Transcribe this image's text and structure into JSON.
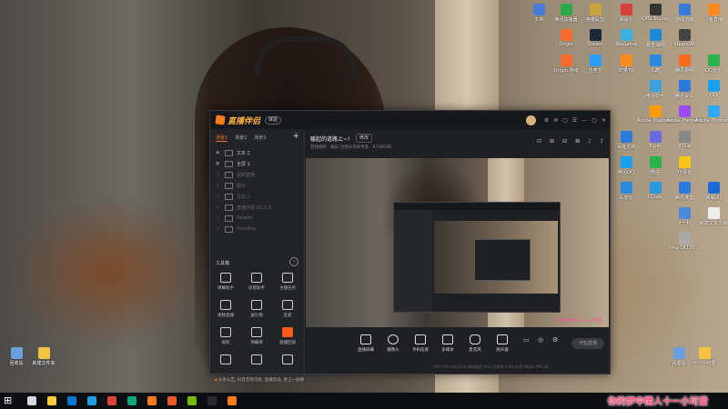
{
  "app": {
    "name": "直播伴侣",
    "badge": "体验",
    "window_controls": [
      "⚙",
      "✉",
      "▢",
      "☰",
      "—",
      "▢",
      "✕"
    ]
  },
  "left_panel": {
    "tabs": [
      "场景1",
      "场景2",
      "场景3"
    ],
    "add": "+",
    "sources": [
      {
        "label": "文本 2",
        "active": true
      },
      {
        "label": "全屏 1",
        "active": true
      },
      {
        "label": "视频直播",
        "active": false
      },
      {
        "label": "图片",
        "active": false
      },
      {
        "label": "文本 1",
        "active": false
      },
      {
        "label": "直播伴侣 V1.2.0",
        "active": false
      },
      {
        "label": "Paladin",
        "active": false
      },
      {
        "label": "Paradise",
        "active": false
      }
    ],
    "tools_title": "工具箱",
    "tools": [
      {
        "label": "弹幕助手",
        "hot": false
      },
      {
        "label": "房管助手",
        "hot": false
      },
      {
        "label": "主播任务",
        "hot": false
      },
      {
        "label": "视频直播",
        "hot": false
      },
      {
        "label": "送礼物",
        "hot": false
      },
      {
        "label": "连麦",
        "hot": false
      },
      {
        "label": "福利",
        "hot": false
      },
      {
        "label": "弹幕库",
        "hot": false
      },
      {
        "label": "直播回放",
        "hot": true
      },
      {
        "label": "",
        "hot": false
      },
      {
        "label": "",
        "hot": false
      },
      {
        "label": "",
        "hot": false
      }
    ],
    "notice": "头条公告, 抖音无限可能, 直播玩法, 更上一层楼"
  },
  "main": {
    "room_title": "暖起的道路上~!",
    "room_tag": "修改",
    "room_meta": "游戏视听 · 娱乐   比特分享好享多 · 873853B",
    "top_icons": [
      "⊡",
      "⊞",
      "⊟",
      "⊠",
      "♪",
      "⇪"
    ],
    "overlay_caption": "你的梦中情人十一小可爱",
    "bottom_items": [
      "直播屏幕",
      "摄像头",
      "手机投屏",
      "多媒体",
      "麦克风",
      "扬声器"
    ],
    "extra_icons": [
      "▭",
      "◎",
      "⚙"
    ],
    "start_live": "开始直播",
    "status_line": "CPU:19%   内存:43%   网络延迟:0ms   丢帧率:0.0%   码率:0kbps   FPS:30"
  },
  "desktop": {
    "right_icons": [
      {
        "label": "文档",
        "color": "#4a7bd8"
      },
      {
        "label": "腾讯加速器",
        "color": "#2ba84a"
      },
      {
        "label": "英雄联盟",
        "color": "#c9a43a"
      },
      {
        "label": "网易云",
        "color": "#d8403a"
      },
      {
        "label": "OBS Studio",
        "color": "#333333"
      },
      {
        "label": "游戏加速",
        "color": "#3a7bd8"
      },
      {
        "label": "斗鱼直播",
        "color": "#ff8a1a"
      },
      {
        "label": "Origin",
        "color": "#f56c2d"
      },
      {
        "label": "Steam",
        "color": "#1b2838"
      },
      {
        "label": "WeGame",
        "color": "#3ab0e0"
      },
      {
        "label": "暴雪战网",
        "color": "#1a8ad8"
      },
      {
        "label": "SteamVR",
        "color": "#444444"
      },
      {
        "label": "Origin·游戏",
        "color": "#f56c2d"
      },
      {
        "label": "应用宝",
        "color": "#2b9ef5"
      },
      {
        "label": "芒果TV",
        "color": "#ff8a1a"
      },
      {
        "label": "优酷",
        "color": "#2a8ae0"
      },
      {
        "label": "腾讯视频",
        "color": "#ff6a1a"
      },
      {
        "label": "QQ音乐",
        "color": "#2bb34a"
      },
      {
        "label": "电话助手",
        "color": "#3aa0e0"
      },
      {
        "label": "腾讯会议",
        "color": "#2a7ae0"
      },
      {
        "label": "QQ",
        "color": "#1aa0f0"
      },
      {
        "label": "Adobe Illustrator",
        "color": "#ff9a00"
      },
      {
        "label": "Adobe Premiere",
        "color": "#9a4af0"
      },
      {
        "label": "Adobe Photoshop",
        "color": "#31a8ff"
      },
      {
        "label": "百度文档",
        "color": "#2a7ae0"
      },
      {
        "label": "Egret",
        "color": "#6a6ae0"
      },
      {
        "label": "XYGs",
        "color": "#888888"
      },
      {
        "label": "腾讯QQ",
        "color": "#1aa0f0"
      },
      {
        "label": "微信",
        "color": "#2bb34a"
      },
      {
        "label": "YY语音",
        "color": "#f5c51a"
      },
      {
        "label": "百度云",
        "color": "#2a8ae0"
      },
      {
        "label": "CCtalk",
        "color": "#2a9ae0"
      },
      {
        "label": "腾讯课堂",
        "color": "#2a7ae0"
      },
      {
        "label": "网易UU",
        "color": "#1a6ad8"
      },
      {
        "label": "十一机",
        "color": "#4a8ad8"
      },
      {
        "label": "新建文本文档",
        "color": "#eeeeee"
      },
      {
        "label": "img-16170...",
        "color": "#aaaaaa"
      }
    ],
    "left_icons": [
      {
        "label": "回收站",
        "color": "#6aa0e0"
      },
      {
        "label": "新建文件夹",
        "color": "#f5c542"
      }
    ],
    "bottom_right_icons": [
      {
        "label": "回收站",
        "color": "#6aa0e0"
      },
      {
        "label": "十一小可爱",
        "color": "#f5c542"
      },
      {
        "label": "新建文件夹",
        "color": "#f5c542"
      }
    ]
  },
  "taskbar": {
    "start_icon": "⊞",
    "apps": [
      {
        "color": "#d8d8d8"
      },
      {
        "color": "#ffc83d"
      },
      {
        "color": "#0078d4"
      },
      {
        "color": "#1fa0e0"
      },
      {
        "color": "#db4437"
      },
      {
        "color": "#0ca47a"
      },
      {
        "color": "#ff7a1a"
      },
      {
        "color": "#e85a2a"
      },
      {
        "color": "#76b900"
      },
      {
        "color": "#2a2a2a"
      },
      {
        "color": "#ff7a1a"
      }
    ]
  },
  "stream_caption": "你的梦中情人十一小可爱"
}
